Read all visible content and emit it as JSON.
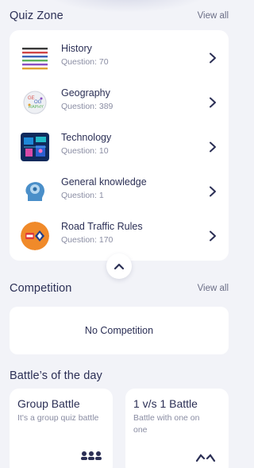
{
  "quiz_zone": {
    "title": "Quiz Zone",
    "view_all": "View all",
    "items": [
      {
        "name": "History",
        "count": "Question: 70",
        "icon": "history-stripes-icon"
      },
      {
        "name": "Geography",
        "count": "Question: 389",
        "icon": "geography-globe-icon"
      },
      {
        "name": "Technology",
        "count": "Question: 10",
        "icon": "technology-circuit-icon"
      },
      {
        "name": "General knowledge",
        "count": "Question: 1",
        "icon": "brain-head-icon"
      },
      {
        "name": "Road Traffic Rules",
        "count": "Question: 170",
        "icon": "traffic-sign-icon"
      }
    ]
  },
  "competition": {
    "title": "Competition",
    "view_all": "View all",
    "empty_text": "No Competition"
  },
  "battles": {
    "title": "Battle’s of the day",
    "cards": [
      {
        "title": "Group Battle",
        "subtitle": "It's a group quiz battle",
        "icon": "group-people-icon"
      },
      {
        "title": "1 v/s 1 Battle",
        "subtitle": "Battle with one on one",
        "icon": "versus-icon"
      }
    ]
  },
  "colors": {
    "background": "#f2f3f8",
    "card": "#ffffff",
    "text_primary": "#2b2f55",
    "text_secondary": "#8a8da3"
  }
}
